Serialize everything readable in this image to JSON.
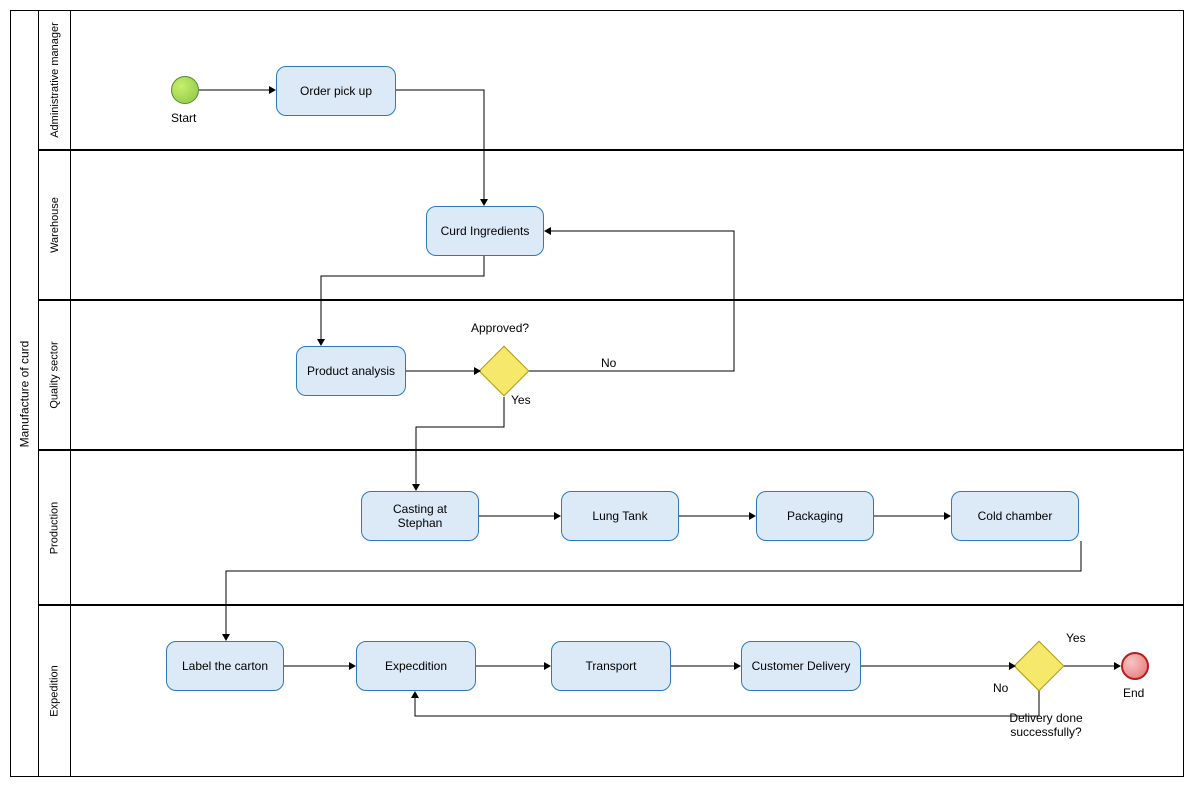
{
  "pool": {
    "title": "Manufacture of curd"
  },
  "lanes": {
    "admin": "Administrative\nmanager",
    "warehouse": "Warehouse",
    "quality": "Quality sector",
    "production": "Production",
    "expedition": "Expedition"
  },
  "events": {
    "start": "Start",
    "end": "End"
  },
  "tasks": {
    "order_pickup": "Order pick up",
    "curd_ingredients": "Curd Ingredients",
    "product_analysis": "Product analysis",
    "casting": "Casting at Stephan",
    "lung_tank": "Lung Tank",
    "packaging": "Packaging",
    "cold_chamber": "Cold chamber",
    "label_carton": "Label the carton",
    "expedition": "Expecdition",
    "transport": "Transport",
    "customer_delivery": "Customer Delivery"
  },
  "gateways": {
    "approved": {
      "label": "Approved?",
      "yes": "Yes",
      "no": "No"
    },
    "delivery": {
      "label": "Delivery done successfully?",
      "yes": "Yes",
      "no": "No"
    }
  }
}
